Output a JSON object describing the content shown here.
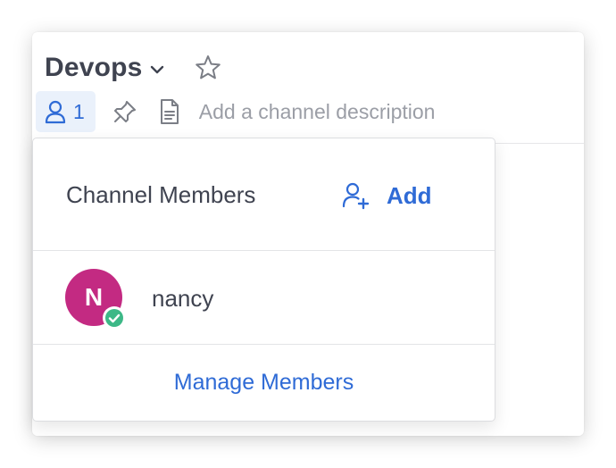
{
  "header": {
    "channel_name": "Devops",
    "member_count": "1",
    "description_placeholder": "Add a channel description",
    "icons": [
      "chevron-down-icon",
      "star-icon",
      "member-icon",
      "pin-icon",
      "file-icon"
    ]
  },
  "members_popover": {
    "title": "Channel Members",
    "add_label": "Add",
    "members": [
      {
        "initial": "N",
        "username": "nancy",
        "avatar_color": "#c32a82",
        "status": "online",
        "status_color": "#3db887"
      }
    ],
    "manage_label": "Manage Members"
  },
  "colors": {
    "accent": "#2f6bd6",
    "text": "#3f4350",
    "muted": "#9b9ea6"
  }
}
